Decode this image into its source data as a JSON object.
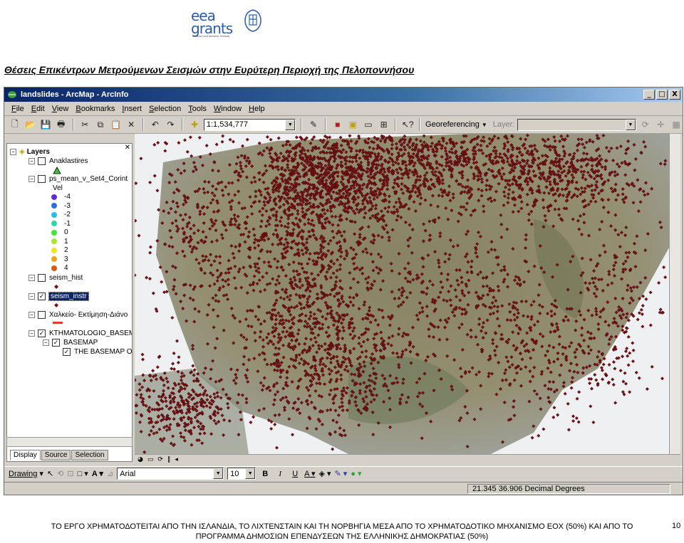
{
  "logo": {
    "line1": "eea",
    "line2": "grants",
    "tagline": "Iceland Liechtenstein Norway"
  },
  "doc_title": "Θέσεις Επικέντρων Μετρούμενων Σεισμών στην Ευρύτερη Περιοχή της Πελοποννήσου",
  "window": {
    "title": "landslides - ArcMap - ArcInfo",
    "controls": {
      "minimize": "_",
      "maximize": "□",
      "close": "X"
    }
  },
  "menu": [
    "File",
    "Edit",
    "View",
    "Bookmarks",
    "Insert",
    "Selection",
    "Tools",
    "Window",
    "Help"
  ],
  "toolbar": {
    "scale": "1:1,534,777",
    "georef_label": "Georeferencing",
    "layer_label": "Layer:",
    "layer_value": ""
  },
  "toc": {
    "root": "Layers",
    "layers": [
      {
        "name": "Anaklastires",
        "checked": false
      },
      {
        "name": "ps_mean_v_Set4_Corint",
        "checked": false,
        "field": "Vel",
        "classes": [
          {
            "label": "-4",
            "color": "#5a2bd6"
          },
          {
            "label": "-3",
            "color": "#2e6ee0"
          },
          {
            "label": "-2",
            "color": "#22c2e8"
          },
          {
            "label": "-1",
            "color": "#2ed6a0"
          },
          {
            "label": "0",
            "color": "#3ee63a"
          },
          {
            "label": "1",
            "color": "#a8e62e"
          },
          {
            "label": "2",
            "color": "#f2e22a"
          },
          {
            "label": "3",
            "color": "#f0a020"
          },
          {
            "label": "4",
            "color": "#d85a18"
          }
        ]
      },
      {
        "name": "seism_hist",
        "checked": false
      },
      {
        "name": "seism_instr",
        "checked": true,
        "selected": true
      },
      {
        "name": "Χαλκείο- Εκτίμηση-Διάνο",
        "checked": false
      },
      {
        "name": "KTHMATOLOGIO_BASEM",
        "checked": true
      },
      {
        "name": "BASEMAP",
        "checked": true
      },
      {
        "name": "THE BASEMAP OI",
        "checked": true
      }
    ],
    "tabs": [
      "Display",
      "Source",
      "Selection"
    ],
    "active_tab": "Display"
  },
  "drawing": {
    "label": "Drawing",
    "font": "Arial",
    "size": "10",
    "styles": [
      "B",
      "I",
      "U"
    ]
  },
  "status": {
    "coords": "21.345  36.906 Decimal Degrees"
  },
  "footer": {
    "line1": "ΤΟ ΕΡΓΟ ΧΡΗΜΑΤΟΔΟΤΕΙΤΑΙ ΑΠΟ ΤΗΝ ΙΣΛΑΝΔΙΑ, ΤΟ ΛΙΧΤΕΝΣΤΑΙΝ ΚΑΙ ΤΗ ΝΟΡΒΗΓΙΑ ΜΕΣΑ ΑΠΟ ΤΟ ΧΡΗΜΑΤΟΔΟΤΙΚΟ ΜΗΧΑΝΙΣΜΟ ΕΟΧ (50%) ΚΑΙ ΑΠΟ ΤΟ",
    "line2": "ΠΡΟΓΡΑΜΜΑ ΔΗΜΟΣΙΩΝ ΕΠΕΝΔΥΣΕΩΝ ΤΗΣ ΕΛΛΗΝΙΚΗΣ ΔΗΜΟΚΡΑΤΙΑΣ (50%)",
    "page": "10"
  },
  "colors": {
    "epicenter": "#7a0f14",
    "title_bar": "#0a246a",
    "highlight": "#0a246a"
  }
}
